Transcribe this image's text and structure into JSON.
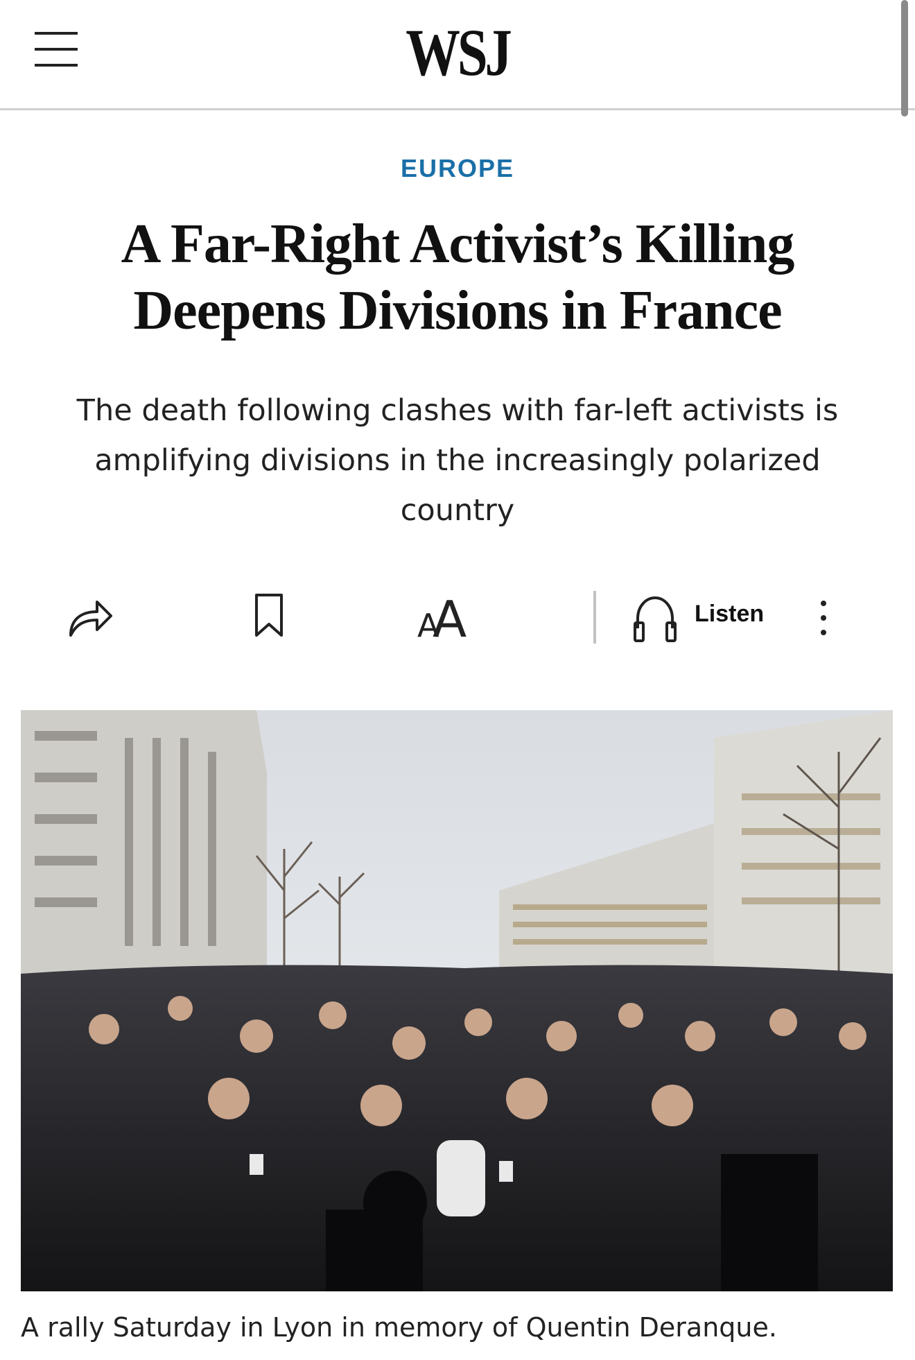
{
  "header": {
    "logo": "WSJ",
    "menu_icon": "hamburger-menu-icon"
  },
  "article": {
    "section": "EUROPE",
    "headline": "A Far-Right Activist’s Killing Deepens Divisions in France",
    "dek": "The death following clashes with far-left activists is amplifying divisions in the increasingly polarized country",
    "caption": "A rally Saturday in Lyon in memory of Quentin Deranque."
  },
  "toolbar": {
    "share_icon": "share-icon",
    "save_icon": "bookmark-icon",
    "text_size_icon": "text-size-icon",
    "text_size_glyph": "AA",
    "listen_icon": "headphones-icon",
    "listen_label": "Listen",
    "more_icon": "more-vertical-icon"
  },
  "colors": {
    "section_accent": "#1a6fa8",
    "text": "#111111",
    "divider": "#cfcfcf"
  }
}
